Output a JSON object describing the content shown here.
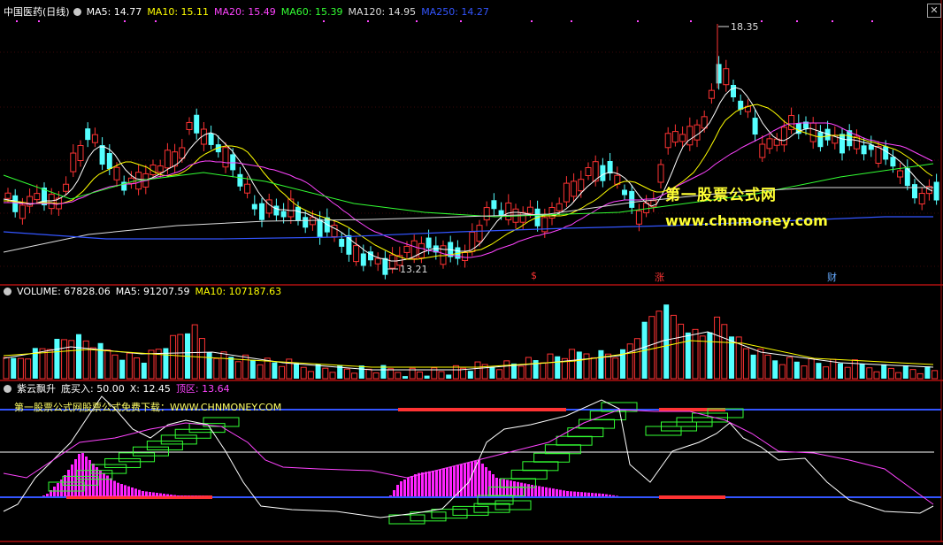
{
  "main_panel": {
    "stock_title": "中国医药(日线)",
    "ma": [
      {
        "label": "MA5: 14.77",
        "color": "#ffffff"
      },
      {
        "label": "MA10: 15.11",
        "color": "#ffff00"
      },
      {
        "label": "MA20: 15.49",
        "color": "#ff44ff"
      },
      {
        "label": "MA60: 15.39",
        "color": "#33ff33"
      },
      {
        "label": "MA120: 14.95",
        "color": "#dddddd"
      },
      {
        "label": "MA250: 14.27",
        "color": "#3355ff"
      }
    ],
    "high_label": "18.35",
    "low_label": "13.21",
    "events": [
      {
        "label": "$",
        "color": "#ff3333"
      },
      {
        "label": "涨",
        "color": "#ff3333"
      },
      {
        "label": "财",
        "color": "#66aaff"
      }
    ]
  },
  "volume_panel": {
    "items": [
      {
        "label": "VOLUME: 67828.06",
        "color": "#ffffff"
      },
      {
        "label": "MA5: 91207.59",
        "color": "#ffffff"
      },
      {
        "label": "MA10: 107187.63",
        "color": "#ffff00"
      }
    ]
  },
  "indicator_panel": {
    "items": [
      {
        "label": "紫云飘升",
        "color": "#ffffff"
      },
      {
        "label": "底买入: 50.00",
        "color": "#ffffff"
      },
      {
        "label": "X: 12.45",
        "color": "#ffffff"
      },
      {
        "label": "顶区: 13.64",
        "color": "#ff44ff"
      }
    ],
    "marquee": "第一股票公式网股票公式免费下载：WWW.CHNMONEY.COM"
  },
  "watermark": {
    "line1": "第一股票公式网",
    "line2": "www.chnmoney.com"
  },
  "colors": {
    "up": "#ff3333",
    "down": "#54ffff",
    "separator": "#b01010",
    "purple_fill": "#ff22ff",
    "green_box": "#33ff33"
  },
  "close_label": "✕"
}
